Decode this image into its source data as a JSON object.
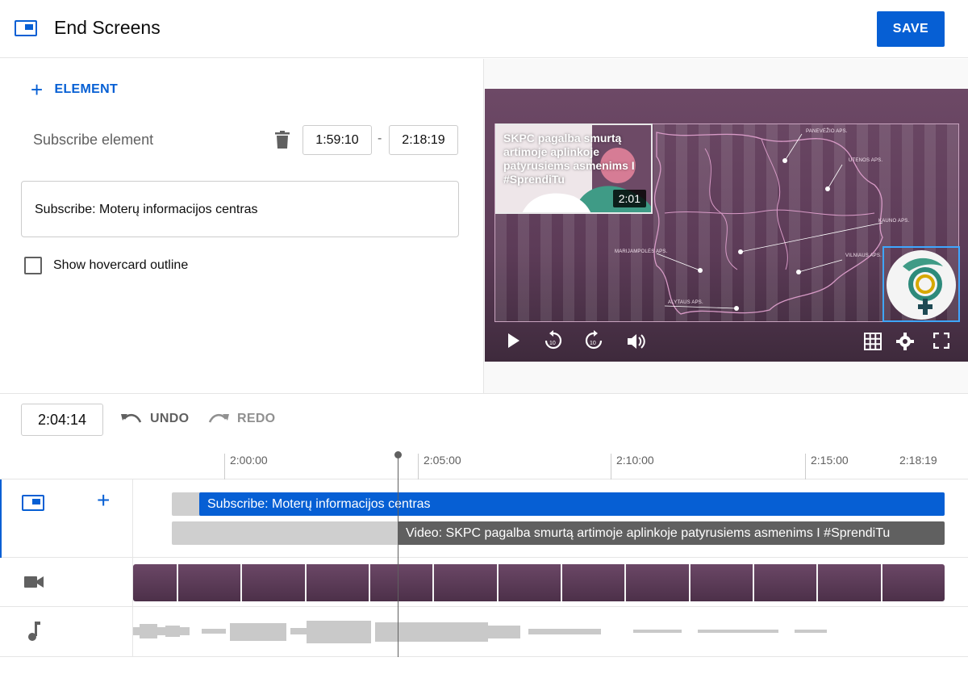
{
  "header": {
    "title": "End Screens",
    "save_label": "SAVE"
  },
  "editor": {
    "add_element_label": "ELEMENT",
    "element_name": "Subscribe element",
    "start_time": "1:59:10",
    "end_time": "2:18:19",
    "time_separator": "-",
    "element_card_text": "Subscribe: Moterų informacijos centras",
    "hovercard_label": "Show hovercard outline",
    "hovercard_checked": false
  },
  "preview": {
    "video_card_title": "SKPC pagalba smurtą artimoje aplinkoje patyrusiems asmenims I #SprendiTu",
    "video_card_duration": "2:01",
    "map_labels": [
      "PANEVĖŽIO APS.",
      "UTENOS APS.",
      "KAUNO APS.",
      "MARIJAMPOLĖS APS.",
      "VILNIAUS APS.",
      "ALYTAUS APS."
    ],
    "controls": [
      "play-icon",
      "replay-10-icon",
      "forward-10-icon",
      "volume-icon",
      "grid-icon",
      "settings-icon",
      "fullscreen-icon"
    ]
  },
  "timeline": {
    "current_time": "2:04:14",
    "undo_label": "UNDO",
    "redo_label": "REDO",
    "ticks": [
      "2:00:00",
      "2:05:00",
      "2:10:00",
      "2:15:00"
    ],
    "end_tick": "2:18:19",
    "subscribe_track": "Subscribe: Moterų informacijos centras",
    "video_track": "Video: SKPC pagalba smurtą artimoje aplinkoje patyrusiems asmenims I #SprendiTu"
  },
  "colors": {
    "accent": "#065fd4",
    "video_bg": "#5c3b57",
    "track_dark": "#606060"
  }
}
